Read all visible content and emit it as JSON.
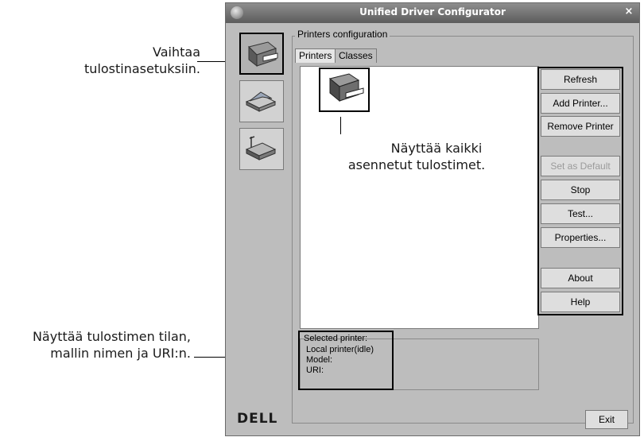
{
  "annotations": {
    "switch_settings": [
      "Vaihtaa",
      "tulostinasetuksiin."
    ],
    "all_printers": [
      "Näyttää kaikki",
      "asennetut tulostimet."
    ],
    "status_info": [
      "Näyttää tulostimen tilan,",
      "mallin nimen ja URI:n."
    ]
  },
  "window": {
    "title": "Unified Driver Configurator",
    "close_icon": "×"
  },
  "sidebar": [
    {
      "icon": "printer-icon"
    },
    {
      "icon": "scanner-icon"
    },
    {
      "icon": "network-port-icon"
    }
  ],
  "group": {
    "title": "Printers configuration",
    "tabs": [
      "Printers",
      "Classes"
    ]
  },
  "buttons": {
    "refresh": "Refresh",
    "add_printer": "Add Printer...",
    "remove_printer": "Remove Printer",
    "set_default": "Set as Default",
    "stop": "Stop",
    "test": "Test...",
    "properties": "Properties...",
    "about": "About",
    "help": "Help",
    "exit": "Exit"
  },
  "selected_printer": {
    "label": "Selected printer:",
    "status": "Local printer(idle)",
    "model": "Model:",
    "uri": "URI:"
  },
  "brand": "DELL"
}
